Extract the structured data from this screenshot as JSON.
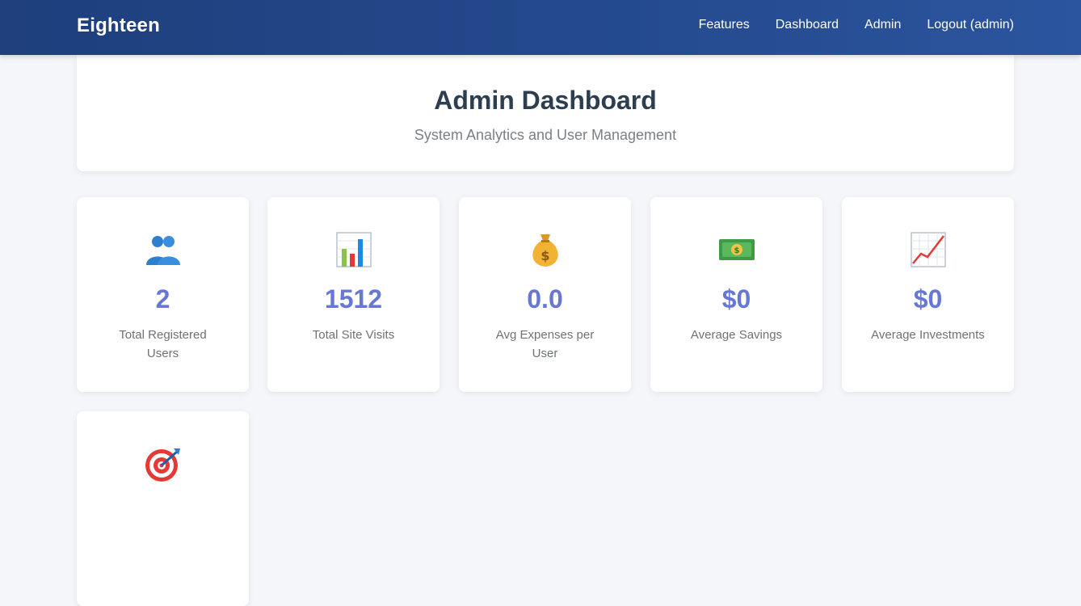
{
  "nav": {
    "brand": "Eighteen",
    "links": [
      "Features",
      "Dashboard",
      "Admin",
      "Logout (admin)"
    ]
  },
  "header": {
    "title": "Admin Dashboard",
    "subtitle": "System Analytics and User Management"
  },
  "stats": [
    {
      "icon": "users-icon",
      "value": "2",
      "label": "Total Registered Users"
    },
    {
      "icon": "bar-chart-icon",
      "value": "1512",
      "label": "Total Site Visits"
    },
    {
      "icon": "money-bag-icon",
      "value": "0.0",
      "label": "Avg Expenses per User"
    },
    {
      "icon": "banknote-icon",
      "value": "$0",
      "label": "Average Savings"
    },
    {
      "icon": "trending-up-icon",
      "value": "$0",
      "label": "Average Investments"
    },
    {
      "icon": "target-icon",
      "value": "",
      "label": ""
    }
  ],
  "colors": {
    "navbar": "#24498d",
    "stat_value": "#6677d6",
    "title": "#2c3e50"
  }
}
